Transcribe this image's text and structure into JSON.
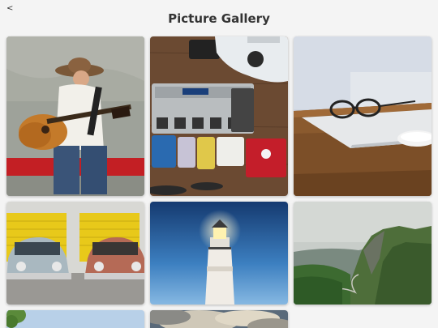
{
  "header": {
    "back_glyph": "<",
    "title": "Picture Gallery"
  },
  "gallery": {
    "photos": [
      "guitar-player-photo",
      "guitar-pedals-photo",
      "glasses-laptop-desk-photo",
      "vintage-cars-photo",
      "lighthouse-photo",
      "green-hills-photo",
      "tree-sky-photo",
      "clouds-photo"
    ]
  }
}
